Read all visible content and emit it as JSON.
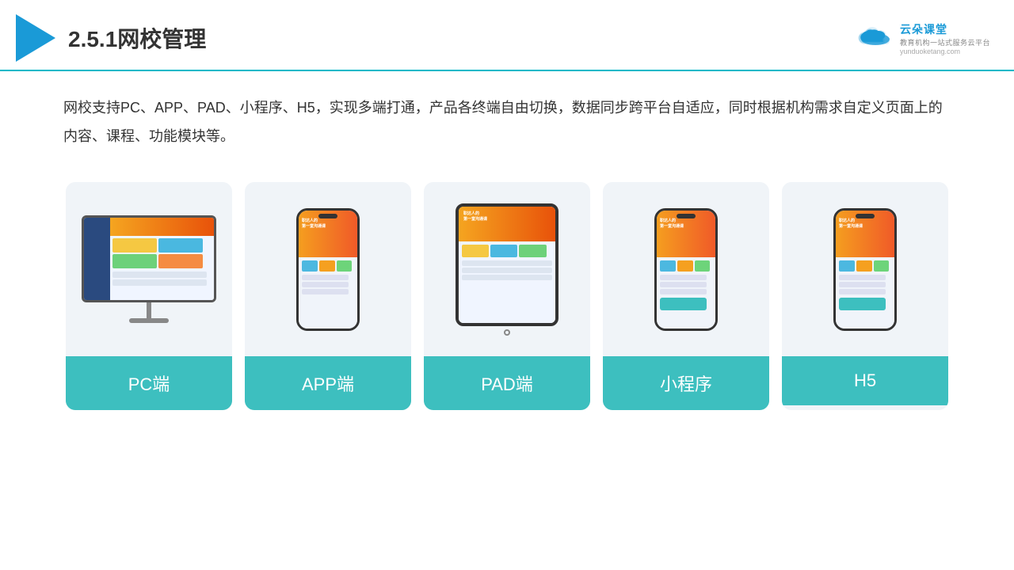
{
  "header": {
    "title": "2.5.1网校管理",
    "logo": {
      "main": "云朵课堂",
      "sub": "教育机构一站式服务云平台",
      "url": "yunduoketang.com"
    }
  },
  "description": "网校支持PC、APP、PAD、小程序、H5，实现多端打通，产品各终端自由切换，数据同步跨平台自适应，同时根据机构需求自定义页面上的内容、课程、功能模块等。",
  "cards": [
    {
      "id": "pc",
      "label": "PC端",
      "device": "pc"
    },
    {
      "id": "app",
      "label": "APP端",
      "device": "phone"
    },
    {
      "id": "pad",
      "label": "PAD端",
      "device": "pad"
    },
    {
      "id": "mini",
      "label": "小程序",
      "device": "phone"
    },
    {
      "id": "h5",
      "label": "H5",
      "device": "phone"
    }
  ],
  "colors": {
    "accent": "#3dbfbf",
    "header_line": "#00b8c8",
    "title_color": "#333333",
    "logo_color": "#1a9ad7"
  }
}
